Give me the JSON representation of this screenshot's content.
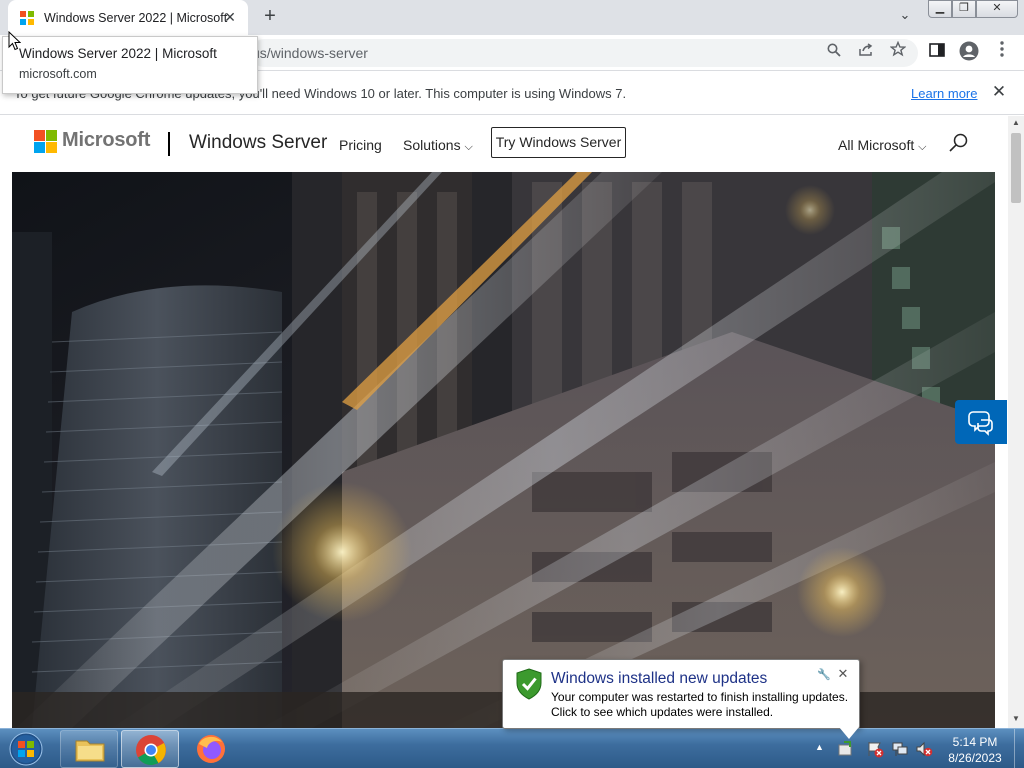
{
  "browser": {
    "tab": {
      "title": "Windows Server 2022 | Microsoft"
    },
    "tooltip": {
      "title": "Windows Server 2022 | Microsoft",
      "domain": "microsoft.com"
    },
    "address_bar": {
      "url": "us/windows-server"
    },
    "infobar": {
      "message": "To get future Google Chrome updates, you'll need Windows 10 or later. This computer is using Windows 7.",
      "link": "Learn more"
    }
  },
  "site": {
    "logo_text": "Microsoft",
    "product": "Windows Server",
    "nav": {
      "pricing": "Pricing",
      "solutions": "Solutions",
      "try_button": "Try Windows Server",
      "all_microsoft": "All Microsoft"
    }
  },
  "notification": {
    "title": "Windows installed new updates",
    "line1": "Your computer was restarted to finish installing updates.",
    "line2": "Click to see which updates were installed."
  },
  "taskbar": {
    "apps": [
      "windows-explorer",
      "google-chrome",
      "firefox"
    ],
    "clock": {
      "time": "5:14 PM",
      "date": "8/26/2023"
    }
  },
  "colors": {
    "ms_red": "#f25022",
    "ms_green": "#7fba00",
    "ms_blue": "#00a4ef",
    "ms_yellow": "#ffb900",
    "link": "#1a73e8",
    "chat_button": "#0067b8"
  }
}
